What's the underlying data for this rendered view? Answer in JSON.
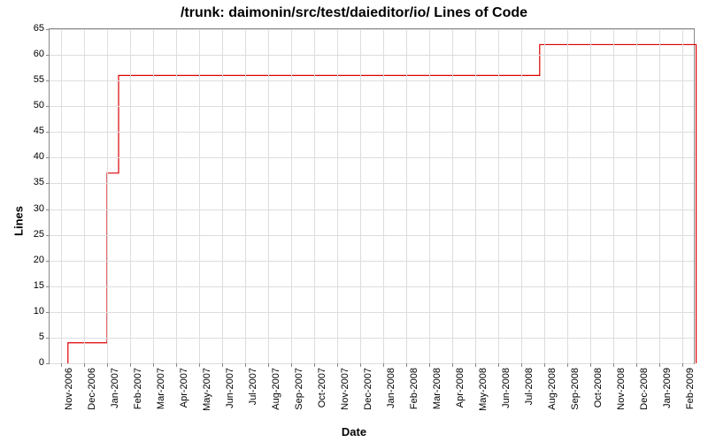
{
  "chart_data": {
    "type": "line",
    "title": "/trunk: daimonin/src/test/daieditor/io/ Lines of Code",
    "xlabel": "Date",
    "ylabel": "Lines",
    "ylim": [
      0,
      65
    ],
    "yticks": [
      0,
      5,
      10,
      15,
      20,
      25,
      30,
      35,
      40,
      45,
      50,
      55,
      60,
      65
    ],
    "categories": [
      "Nov-2006",
      "Dec-2006",
      "Jan-2007",
      "Feb-2007",
      "Mar-2007",
      "Apr-2007",
      "May-2007",
      "Jun-2007",
      "Jul-2007",
      "Aug-2007",
      "Sep-2007",
      "Oct-2007",
      "Nov-2007",
      "Dec-2007",
      "Jan-2008",
      "Feb-2008",
      "Mar-2008",
      "Apr-2008",
      "May-2008",
      "Jun-2008",
      "Jul-2008",
      "Aug-2008",
      "Sep-2008",
      "Oct-2008",
      "Nov-2008",
      "Dec-2008",
      "Jan-2009",
      "Feb-2009"
    ],
    "series": [
      {
        "name": "Lines of Code",
        "color": "#dd0000",
        "points": [
          {
            "x": 0.3,
            "y": 0
          },
          {
            "x": 0.3,
            "y": 4
          },
          {
            "x": 2.0,
            "y": 4
          },
          {
            "x": 2.0,
            "y": 37
          },
          {
            "x": 2.5,
            "y": 37
          },
          {
            "x": 2.5,
            "y": 56
          },
          {
            "x": 20.8,
            "y": 56
          },
          {
            "x": 20.8,
            "y": 62
          },
          {
            "x": 27.6,
            "y": 62
          },
          {
            "x": 27.6,
            "y": 0
          }
        ]
      }
    ]
  }
}
